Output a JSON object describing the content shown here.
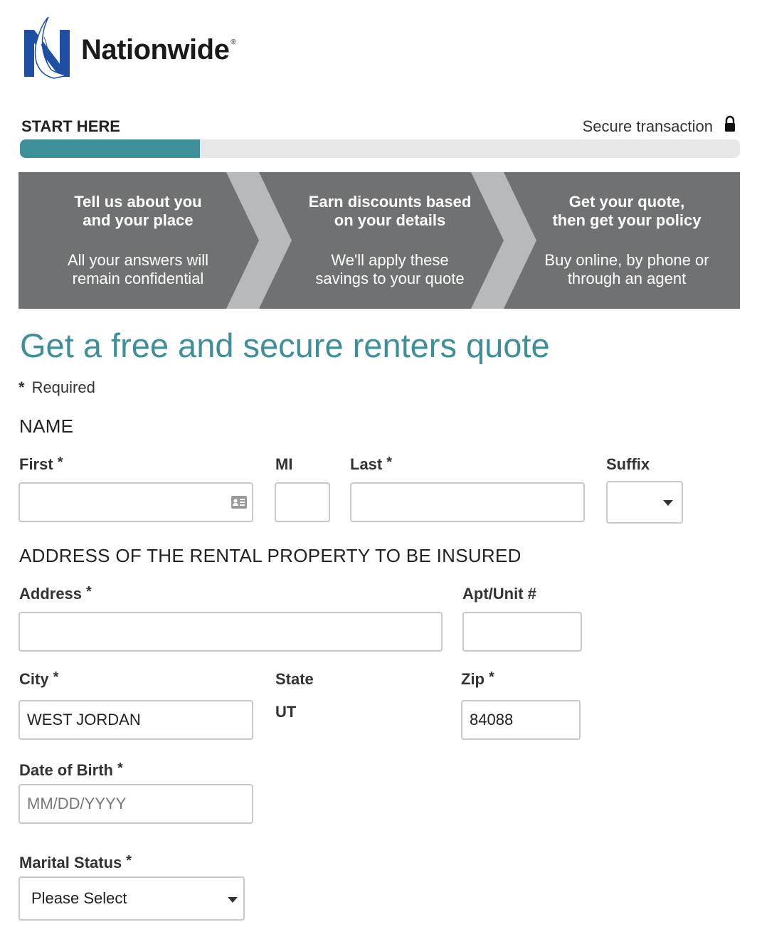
{
  "brand": {
    "name": "Nationwide",
    "reg": "®"
  },
  "progress": {
    "start_label": "START HERE",
    "secure_label": "Secure transaction",
    "percent": 25
  },
  "steps": [
    {
      "title_line1": "Tell us about you",
      "title_line2": "and your place",
      "desc_line1": "All your answers will",
      "desc_line2": "remain confidential"
    },
    {
      "title_line1": "Earn discounts based",
      "title_line2": "on your details",
      "desc_line1": "We'll apply these",
      "desc_line2": "savings to your quote"
    },
    {
      "title_line1": "Get your quote,",
      "title_line2": "then get your policy",
      "desc_line1": "Buy online, by phone or",
      "desc_line2": "through an agent"
    }
  ],
  "page": {
    "title": "Get a free and secure renters quote",
    "required_star": "*",
    "required_label": "Required"
  },
  "name_section": {
    "heading": "NAME",
    "first_label": "First",
    "mi_label": "MI",
    "last_label": "Last",
    "suffix_label": "Suffix",
    "req": "*"
  },
  "address_section": {
    "heading": "ADDRESS OF THE RENTAL PROPERTY TO BE INSURED",
    "address_label": "Address",
    "apt_label": "Apt/Unit #",
    "city_label": "City",
    "city_value": "WEST JORDAN",
    "state_label": "State",
    "state_value": "UT",
    "zip_label": "Zip",
    "zip_value": "84088",
    "req": "*"
  },
  "personal": {
    "dob_label": "Date of Birth",
    "dob_placeholder": "MM/DD/YYYY",
    "marital_label": "Marital Status",
    "marital_value": "Please Select",
    "req": "*"
  },
  "colors": {
    "accent": "#3f8f9a",
    "banner": "#707172",
    "logo_blue": "#1f4fa3"
  }
}
